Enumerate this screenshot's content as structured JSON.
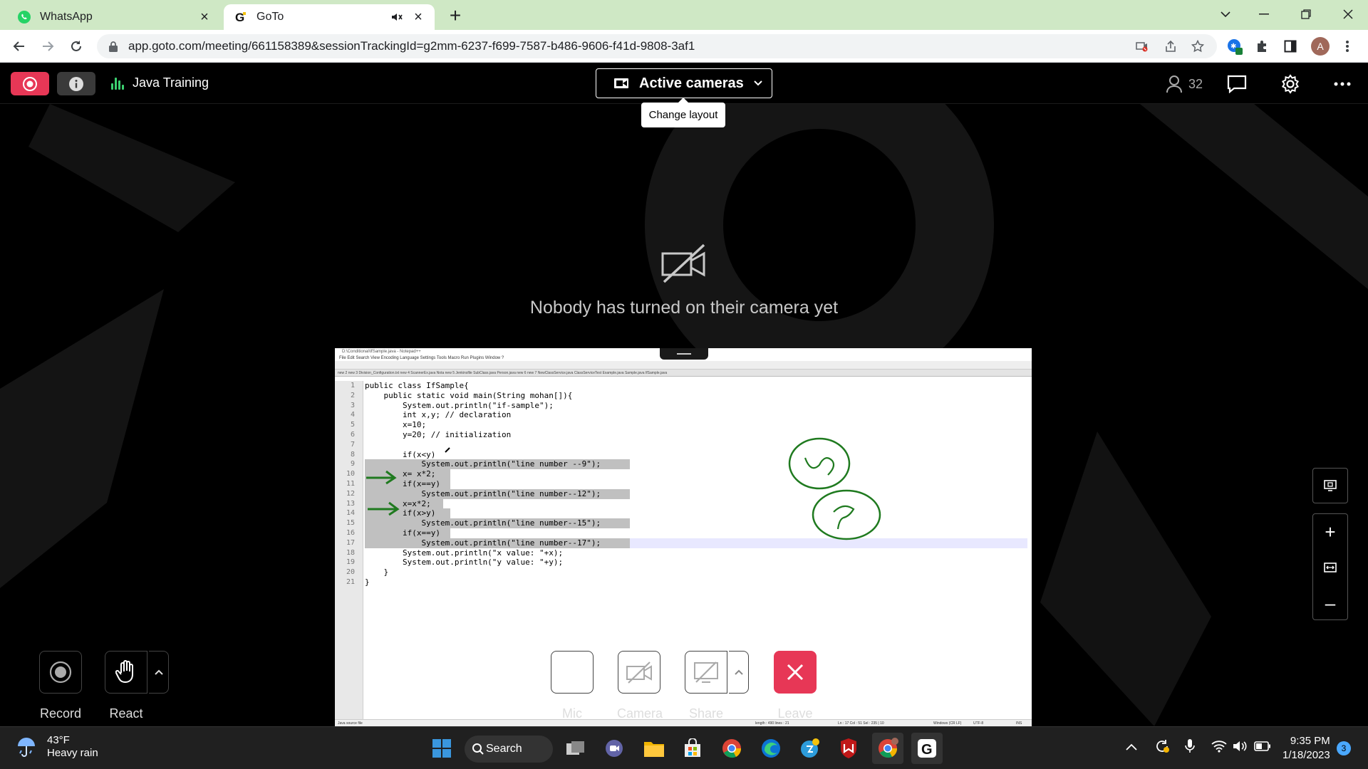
{
  "browser": {
    "tabs": [
      {
        "title": "WhatsApp",
        "icon": "whatsapp-icon"
      },
      {
        "title": "GoTo",
        "icon": "goto-icon",
        "audio": true
      }
    ],
    "url": "app.goto.com/meeting/661158389&sessionTrackingId=g2mm-6237-f699-7587-b486-9606-f41d-9808-3af1",
    "profile_initial": "A",
    "extension_badge": "3"
  },
  "meeting": {
    "title": "Java Training",
    "view_button": "Active cameras",
    "tooltip": "Change layout",
    "participant_count": "32",
    "empty_message": "Nobody has turned on their camera yet"
  },
  "shared_screen": {
    "window_title": "D:\\Conditional\\IfSample.java - Notepad++",
    "menu": "File  Edit  Search  View  Encoding  Language  Settings  Tools  Macro  Run  Plugins  Window  ?",
    "tabs_text": "new 2  new 3  Division_Configuration.txt  new 4  ScannerEx.java  Nota  new 5  Jenkinsfile  SubClass.java  Person.java  new 6  new 7  NewClassService.java  ClassServiceTest  Example.java  Sample.java  IfSample.java",
    "code_lines": [
      "public class IfSample{",
      "    public static void main(String mohan[]){",
      "        System.out.println(\"if-sample\");",
      "        int x,y; // declaration",
      "        x=10;",
      "        y=20; // initialization",
      "",
      "        if(x<y)",
      "            System.out.println(\"line number --9\");",
      "        x= x*2;",
      "        if(x==y)",
      "            System.out.println(\"line number--12\");",
      "        x=x*2;",
      "        if(x>y)",
      "            System.out.println(\"line number--15\");",
      "        if(x==y)",
      "            System.out.println(\"line number--17\");",
      "        System.out.println(\"x value: \"+x);",
      "        System.out.println(\"y value: \"+y);",
      "    }",
      "}"
    ],
    "status": {
      "left": "Java source file",
      "length": "length : 490   lines : 21",
      "position": "Ln : 17   Col : 51   Sel : 235 | 10",
      "eol": "Windows (CR LF)",
      "encoding": "UTF-8",
      "mode": "INS"
    },
    "annotation_color": "#1f7a1f"
  },
  "controls": {
    "record": "Record",
    "react": "React",
    "mic": "Mic",
    "camera": "Camera",
    "share": "Share",
    "leave": "Leave"
  },
  "taskbar": {
    "weather_temp": "43°F",
    "weather_desc": "Heavy rain",
    "search_label": "Search",
    "time": "9:35 PM",
    "date": "1/18/2023",
    "notifications": "3"
  },
  "colors": {
    "record_red": "#e73756",
    "tab_strip": "#cfe8c5",
    "audio_bars": "#3cd070"
  }
}
